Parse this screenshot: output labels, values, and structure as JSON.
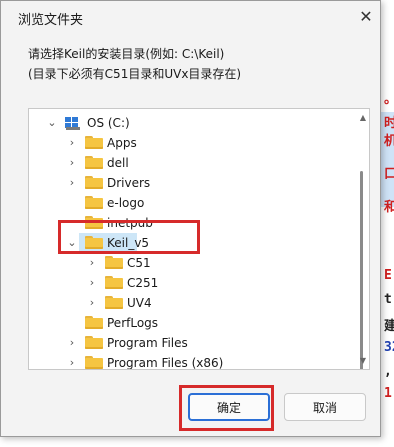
{
  "dialog": {
    "title": "浏览文件夹",
    "close_glyph": "✕",
    "instruction_line1": "请选择Keil的安装目录(例如: C:\\Keil)",
    "instruction_line2": "(目录下必须有C51目录和UVx目录存在)"
  },
  "tree": {
    "drive": {
      "label": "OS (C:)",
      "icon": "windows-drive-icon"
    },
    "items": [
      {
        "label": "Apps",
        "level": 1,
        "expander": "›"
      },
      {
        "label": "dell",
        "level": 1,
        "expander": "›"
      },
      {
        "label": "Drivers",
        "level": 1,
        "expander": "›"
      },
      {
        "label": "e-logo",
        "level": 1,
        "expander": ""
      },
      {
        "label": "inetpub",
        "level": 1,
        "expander": ""
      },
      {
        "label": "Keil_v5",
        "level": 1,
        "expander": "⌄",
        "selected": true
      },
      {
        "label": "C51",
        "level": 2,
        "expander": "›"
      },
      {
        "label": "C251",
        "level": 2,
        "expander": "›"
      },
      {
        "label": "UV4",
        "level": 2,
        "expander": "›"
      },
      {
        "label": "PerfLogs",
        "level": 1,
        "expander": ""
      },
      {
        "label": "Program Files",
        "level": 1,
        "expander": "›"
      },
      {
        "label": "Program Files (x86)",
        "level": 1,
        "expander": "›"
      }
    ]
  },
  "buttons": {
    "ok_label": "确定",
    "cancel_label": "取消"
  },
  "background_fragments": [
    "。",
    "时",
    "机",
    "口",
    "和",
    "E",
    "t",
    "建",
    "32",
    ",",
    "1"
  ],
  "colors": {
    "highlight": "#d62a2a",
    "selection": "#cde6f7",
    "folder": "#f5c542",
    "primary_border": "#2b6fd6"
  }
}
